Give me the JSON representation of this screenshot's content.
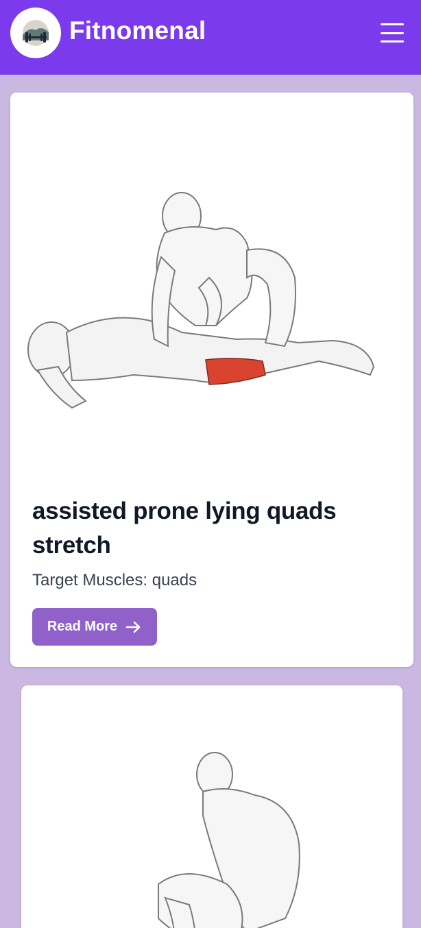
{
  "header": {
    "brand": "Fitnomenal",
    "logo_icon": "dumbbell-icon",
    "menu_icon": "hamburger-menu-icon",
    "colors": {
      "bar": "#7c3aed",
      "page_bg": "#cab8e3"
    }
  },
  "cards": [
    {
      "image_icon": "stretch-illustration",
      "title": "assisted prone lying quads stretch",
      "target": "Target Muscles: quads",
      "button_label": "Read More",
      "button_icon": "arrow-right-icon",
      "button_color": "#9061c9"
    },
    {
      "image_icon": "stretch-illustration"
    }
  ]
}
